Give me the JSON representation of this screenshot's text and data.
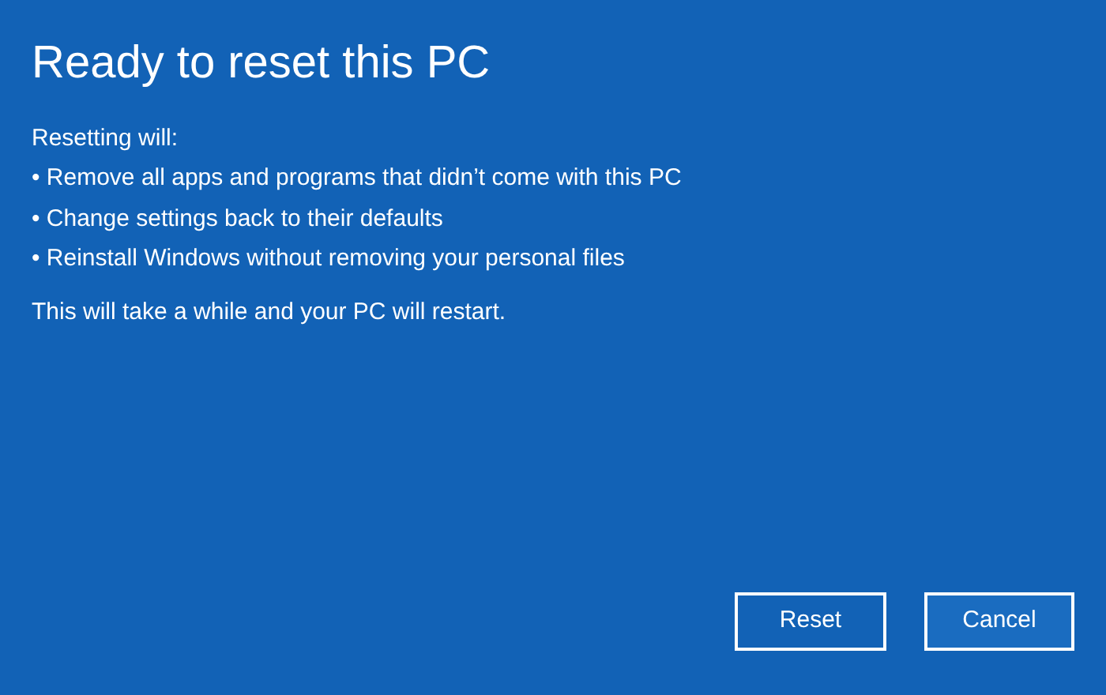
{
  "title": "Ready to reset this PC",
  "intro": "Resetting will:",
  "bullets": [
    "• Remove all apps and programs that didn’t come with this PC",
    "• Change settings back to their defaults",
    "• Reinstall Windows without removing your personal files"
  ],
  "note": "This will take a while and your PC will restart.",
  "buttons": [
    {
      "label": "Reset",
      "kind": "primary"
    },
    {
      "label": "Cancel",
      "kind": "secondary"
    }
  ]
}
